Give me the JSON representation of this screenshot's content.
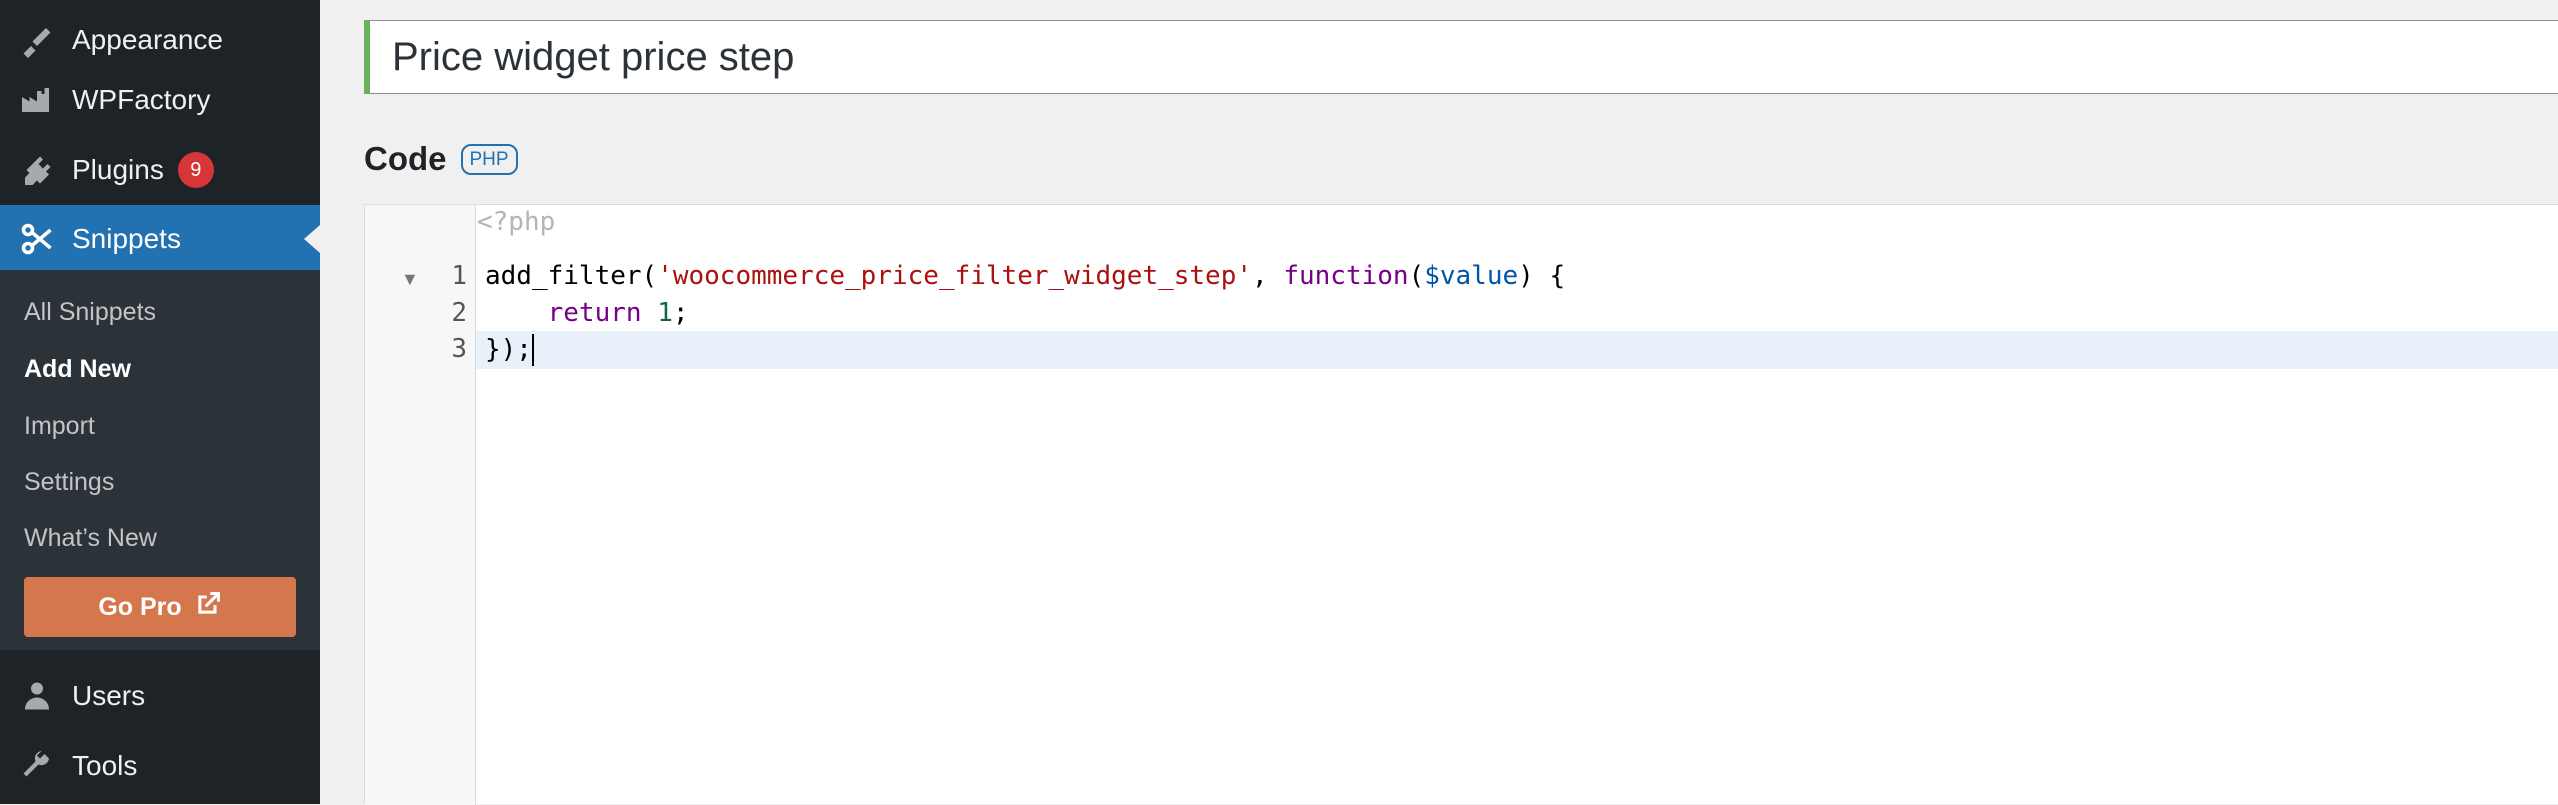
{
  "sidebar": {
    "items": [
      {
        "label": "Appearance",
        "icon": "paintbrush-icon"
      },
      {
        "label": "WPFactory",
        "icon": "factory-icon"
      },
      {
        "label": "Plugins",
        "icon": "plug-icon",
        "badge": "9"
      },
      {
        "label": "Snippets",
        "icon": "scissors-icon"
      },
      {
        "label": "Users",
        "icon": "user-icon"
      },
      {
        "label": "Tools",
        "icon": "wrench-icon"
      }
    ],
    "submenu": [
      "All Snippets",
      "Add New",
      "Import",
      "Settings",
      "What’s New"
    ],
    "go_pro": "Go Pro"
  },
  "main": {
    "title_value": "Price widget price step",
    "code_heading": "Code",
    "language_badge": "PHP"
  },
  "editor": {
    "php_open_tag": "<?php",
    "line_numbers": [
      "1",
      "2",
      "3"
    ],
    "lines": [
      [
        {
          "t": "add_filter(",
          "c": "plain"
        },
        {
          "t": "'woocommerce_price_filter_widget_step'",
          "c": "str"
        },
        {
          "t": ", ",
          "c": "plain"
        },
        {
          "t": "function",
          "c": "kw"
        },
        {
          "t": "(",
          "c": "plain"
        },
        {
          "t": "$value",
          "c": "var"
        },
        {
          "t": ") {",
          "c": "plain"
        }
      ],
      [
        {
          "t": "    ",
          "c": "plain"
        },
        {
          "t": "return",
          "c": "kw"
        },
        {
          "t": " ",
          "c": "plain"
        },
        {
          "t": "1",
          "c": "num"
        },
        {
          "t": ";",
          "c": "plain"
        }
      ],
      [
        {
          "t": "});",
          "c": "plain"
        }
      ]
    ]
  },
  "colors": {
    "sidebar_bg": "#1d2327",
    "submenu_bg": "#2c3338",
    "active_menu": "#2271b1",
    "go_pro": "#d5774d",
    "badge": "#d63638",
    "title_accent": "#68b35c"
  }
}
